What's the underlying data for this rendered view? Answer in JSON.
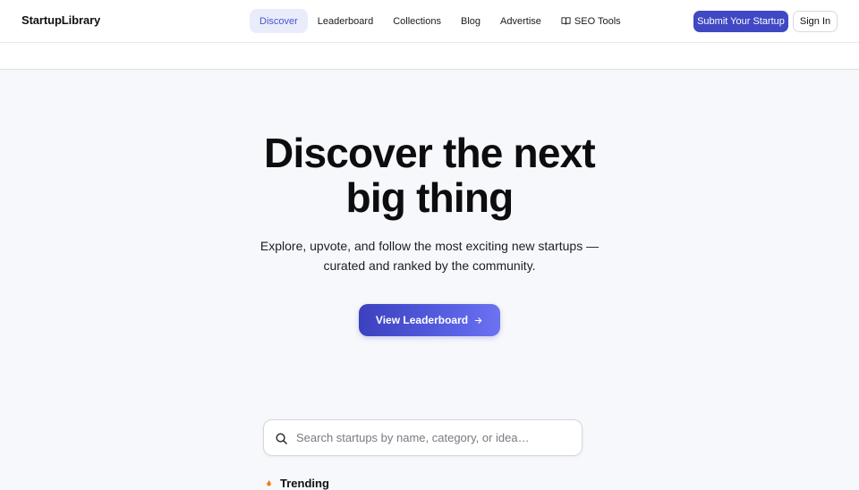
{
  "header": {
    "brand": "StartupLibrary",
    "nav": [
      {
        "label": "Discover",
        "active": true
      },
      {
        "label": "Leaderboard"
      },
      {
        "label": "Collections"
      },
      {
        "label": "Blog"
      },
      {
        "label": "Advertise"
      },
      {
        "label": "SEO Tools",
        "icon": "book-icon"
      }
    ],
    "submit_label": "Submit Your Startup",
    "signin_label": "Sign In"
  },
  "hero": {
    "title_line1": "Discover the next",
    "title_line2": "big thing",
    "subtitle_line1": "Explore, upvote, and follow the most exciting new startups —",
    "subtitle_line2": "curated and ranked by the community.",
    "cta_label": "View Leaderboard",
    "cta_icon": "arrow-right-icon"
  },
  "search": {
    "placeholder": "Search startups by name, category, or idea…",
    "value": "",
    "icon": "search-icon"
  },
  "trending": {
    "label": "Trending",
    "icon": "flame-icon"
  },
  "colors": {
    "accent": "#4048c4",
    "active_nav_bg": "#e9ecfb",
    "active_nav_text": "#4a55c9",
    "trending_icon": "#f07a1a"
  }
}
